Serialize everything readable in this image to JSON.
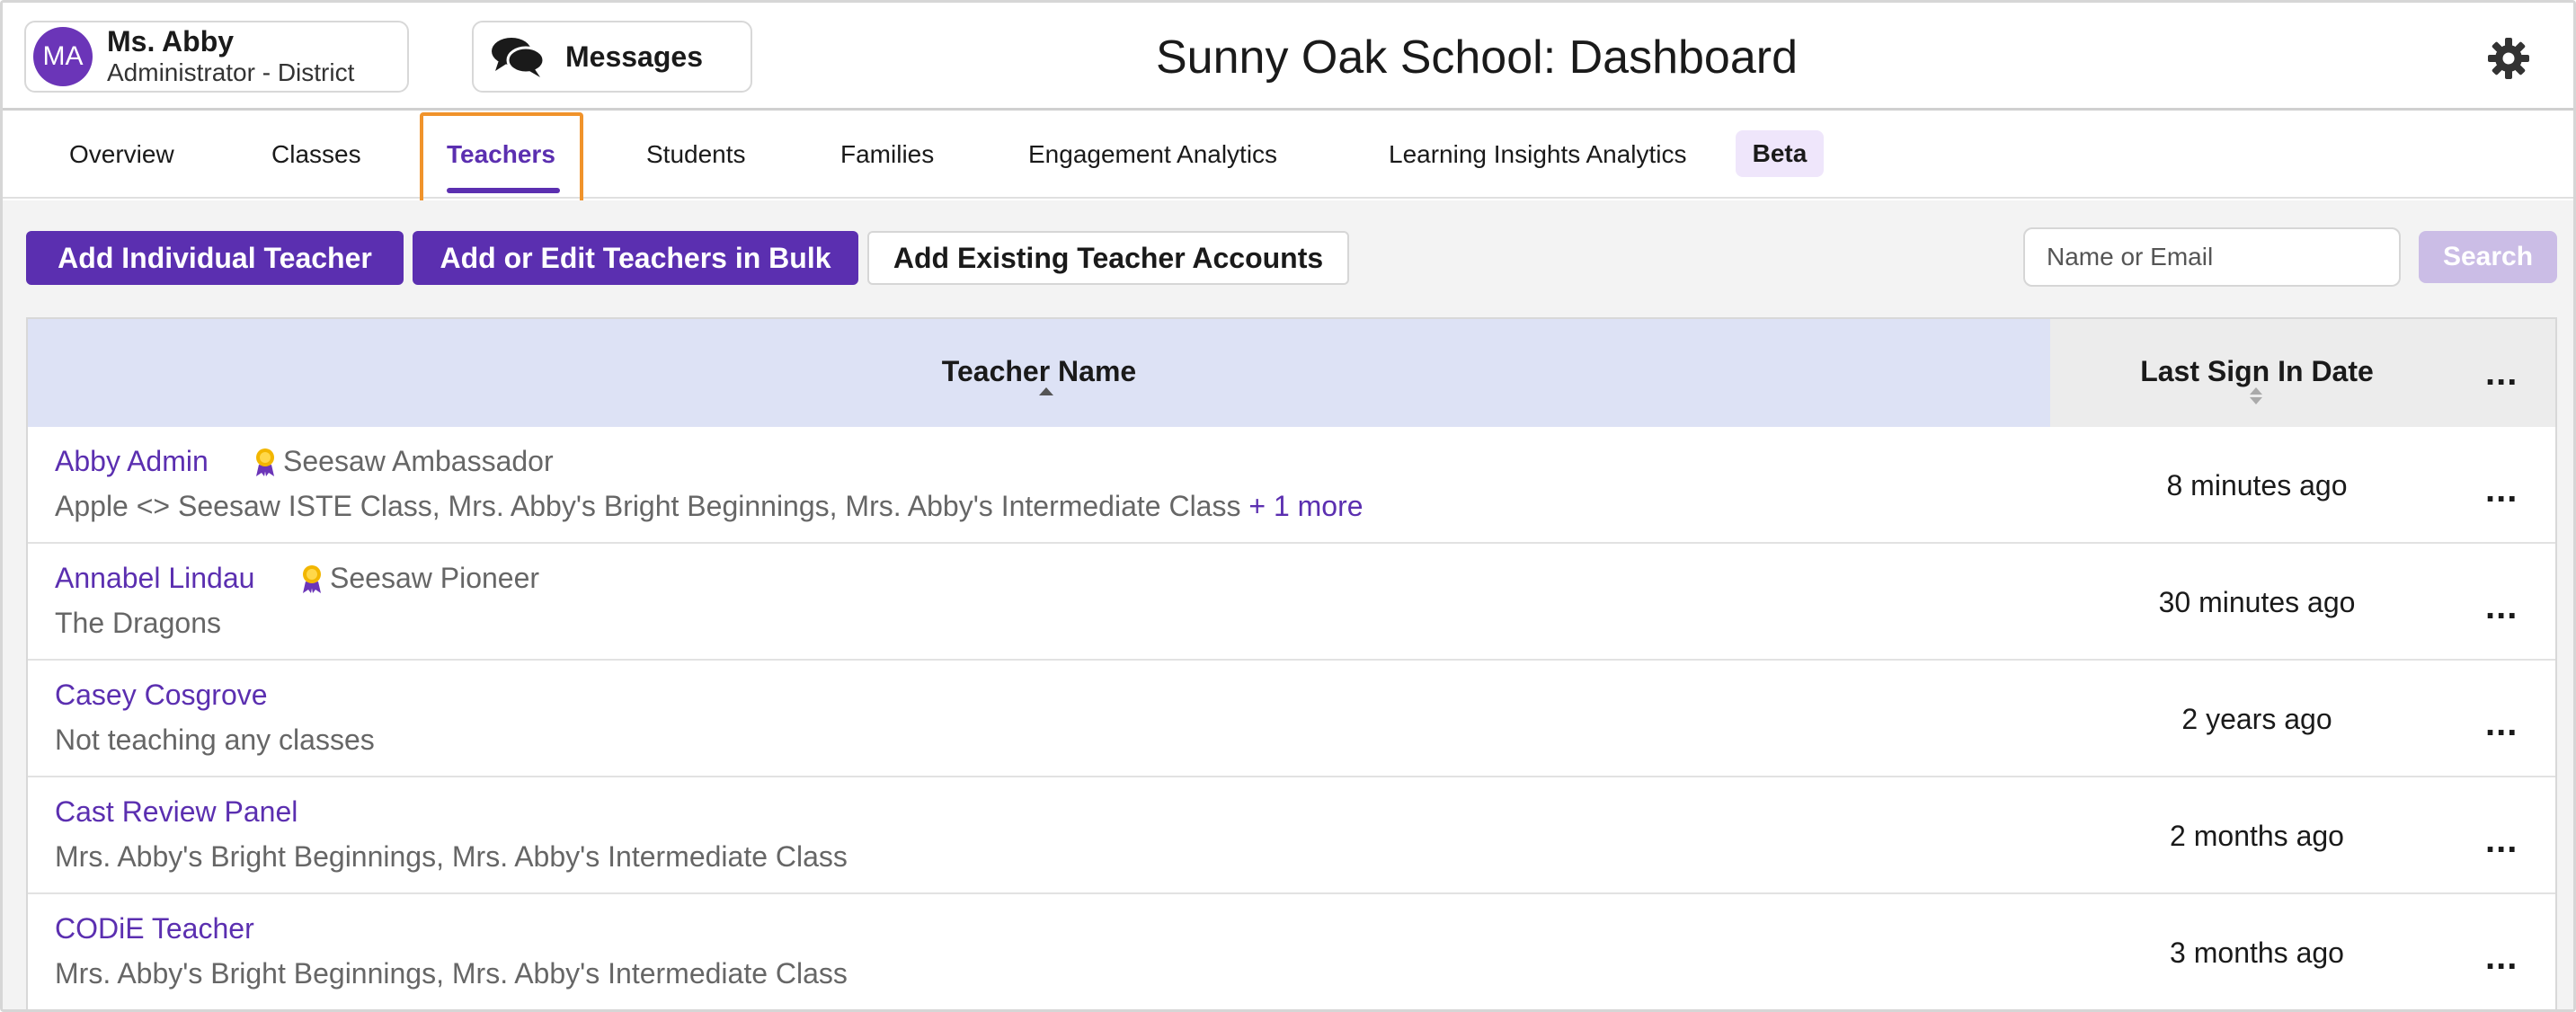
{
  "header": {
    "user": {
      "initials": "MA",
      "name": "Ms. Abby",
      "role": "Administrator - District"
    },
    "messages_label": "Messages",
    "title": "Sunny Oak School: Dashboard"
  },
  "tabs": [
    {
      "label": "Overview"
    },
    {
      "label": "Classes"
    },
    {
      "label": "Teachers",
      "active": true
    },
    {
      "label": "Students"
    },
    {
      "label": "Families"
    },
    {
      "label": "Engagement Analytics"
    },
    {
      "label": "Learning Insights Analytics"
    }
  ],
  "beta_label": "Beta",
  "toolbar": {
    "add_individual": "Add Individual Teacher",
    "add_bulk": "Add or Edit Teachers in Bulk",
    "add_existing": "Add Existing Teacher Accounts",
    "search_placeholder": "Name or Email",
    "search_label": "Search"
  },
  "table": {
    "columns": {
      "name": "Teacher Name",
      "last_sign_in": "Last Sign In Date",
      "more": "..."
    },
    "rows": [
      {
        "name": "Abby Admin",
        "badge": "Seesaw Ambassador",
        "classes": "Apple <> Seesaw ISTE Class, Mrs. Abby's Bright Beginnings, Mrs. Abby's Intermediate Class",
        "more": "+ 1 more",
        "last_sign_in": "8 minutes ago"
      },
      {
        "name": "Annabel Lindau",
        "badge": "Seesaw Pioneer",
        "classes": "The Dragons",
        "last_sign_in": "30 minutes ago"
      },
      {
        "name": "Casey Cosgrove",
        "classes": "Not teaching any classes",
        "last_sign_in": "2 years ago"
      },
      {
        "name": "Cast Review Panel",
        "classes": "Mrs. Abby's Bright Beginnings, Mrs. Abby's Intermediate Class",
        "last_sign_in": "2 months ago"
      },
      {
        "name": "CODiE Teacher",
        "classes": "Mrs. Abby's Bright Beginnings, Mrs. Abby's Intermediate Class",
        "last_sign_in": "3 months ago"
      }
    ],
    "row_menu": "..."
  },
  "colors": {
    "brand_purple": "#5b2fb0",
    "highlight_orange": "#f0932b",
    "header_blue": "#dde2f5"
  }
}
